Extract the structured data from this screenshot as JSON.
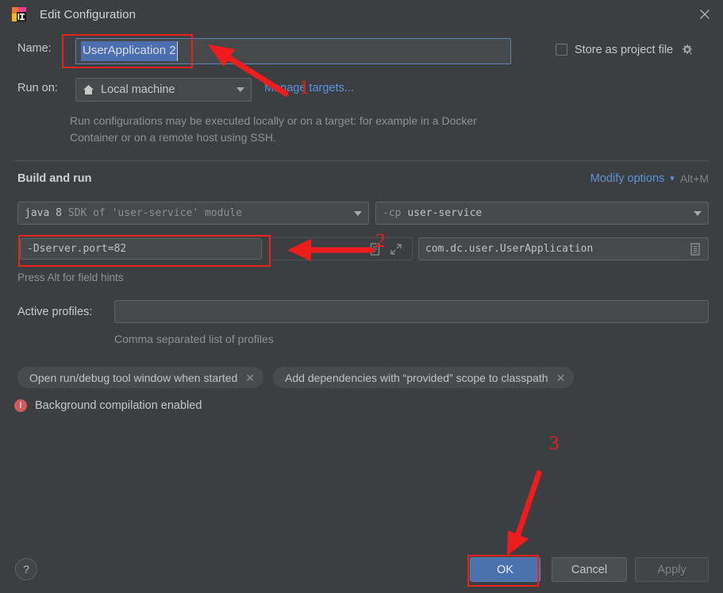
{
  "window": {
    "title": "Edit Configuration",
    "app_icon": "intellij-idea-icon",
    "close_icon": "close-icon"
  },
  "name_row": {
    "label": "Name:",
    "value": "UserApplication 2",
    "store_checkbox_label": "Store as project file",
    "store_checkbox_checked": false,
    "gear_icon": "gear-icon"
  },
  "run_on": {
    "label": "Run on:",
    "value": "Local machine",
    "icon": "home-icon",
    "manage_targets_link": "Manage targets..."
  },
  "description": "Run configurations may be executed locally or on a target: for example in a Docker Container or on a remote host using SSH.",
  "build_and_run": {
    "section_title": "Build and run",
    "modify_options_link": "Modify options",
    "modify_options_shortcut": "Alt+M",
    "sdk": {
      "primary": "java 8",
      "secondary": "SDK of 'user-service' module"
    },
    "classpath": {
      "flag": "-cp",
      "value": "user-service"
    },
    "vm_options": "-Dserver.port=82",
    "vm_icons": [
      "macro-icon",
      "expand-icon"
    ],
    "main_class": "com.dc.user.UserApplication",
    "main_class_browse_icon": "browse-class-icon",
    "field_hint": "Press Alt for field hints"
  },
  "active_profiles": {
    "label": "Active profiles:",
    "value": "",
    "hint": "Comma separated list of profiles"
  },
  "option_chips": [
    {
      "label": "Open run/debug tool window when started",
      "close_icon": "chip-close-icon"
    },
    {
      "label": "Add dependencies with “provided” scope to classpath",
      "close_icon": "chip-close-icon"
    }
  ],
  "status": {
    "icon": "error-icon",
    "icon_glyph": "!",
    "message": "Background compilation enabled"
  },
  "footer": {
    "help_label": "?",
    "ok_label": "OK",
    "cancel_label": "Cancel",
    "apply_label": "Apply",
    "apply_enabled": false
  },
  "annotations": {
    "marker_1": "1",
    "marker_2": "2",
    "marker_3": "3",
    "color": "#ee1c1c"
  }
}
